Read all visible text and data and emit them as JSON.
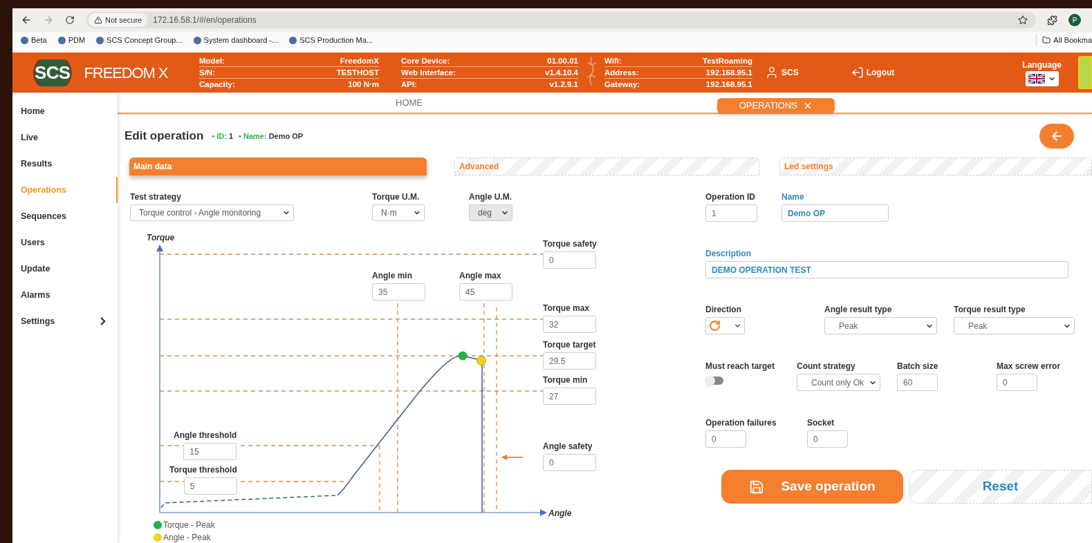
{
  "browser": {
    "security": "Not secure",
    "url": "172.16.58.1/#/en/operations",
    "profile": "P",
    "bookmarks": [
      "Beta",
      "PDM",
      "SCS Concept Group...",
      "System dashboard -...",
      "SCS Production Ma..."
    ],
    "all_bookmarks": "All Bookma"
  },
  "header": {
    "logo": "SCS",
    "product": "FREEDOM X",
    "info": [
      [
        {
          "label": "Model:",
          "value": "FreedomX"
        },
        {
          "label": "S/N:",
          "value": "TESTHOST"
        },
        {
          "label": "Capacity:",
          "value": "100 N·m"
        }
      ],
      [
        {
          "label": "Core Device:",
          "value": "01.00.01"
        },
        {
          "label": "Web Interface:",
          "value": "v1.4.10.4"
        },
        {
          "label": "API:",
          "value": "v1.2.9.1"
        }
      ],
      [
        {
          "label": "Wifi:",
          "value": "TestRoaming"
        },
        {
          "label": "Address:",
          "value": "192.168.95.1"
        },
        {
          "label": "Gateway:",
          "value": "192.168.95.1"
        }
      ]
    ],
    "user": "SCS",
    "logout": "Logout",
    "language": "Language"
  },
  "page_tabs": [
    {
      "label": "HOME",
      "selected": false
    },
    {
      "label": "OPERATIONS",
      "selected": true
    }
  ],
  "sidebar": {
    "items": [
      {
        "label": "Home",
        "selected": false
      },
      {
        "label": "Live",
        "selected": false
      },
      {
        "label": "Results",
        "selected": false
      },
      {
        "label": "Operations",
        "selected": true
      },
      {
        "label": "Sequences",
        "selected": false
      },
      {
        "label": "Users",
        "selected": false
      },
      {
        "label": "Update",
        "selected": false
      },
      {
        "label": "Alarms",
        "selected": false
      },
      {
        "label": "Settings",
        "selected": false,
        "expandable": true
      }
    ]
  },
  "title": "Edit operation",
  "id_label": "• ID:",
  "id_value": "1",
  "name_label": "• Name:",
  "name_value": "Demo OP",
  "section_tabs": [
    {
      "label": "Main data",
      "selected": true
    },
    {
      "label": "Advanced",
      "selected": false
    },
    {
      "label": "Led settings",
      "selected": false
    }
  ],
  "selects": [
    {
      "label": "Test strategy",
      "value": "Torque control - Angle monitoring",
      "disabled": false
    },
    {
      "label": "Torque U.M.",
      "value": "N·m",
      "disabled": false
    },
    {
      "label": "Angle U.M.",
      "value": "deg",
      "disabled": true
    }
  ],
  "chart": {
    "y_label": "Torque",
    "x_label": "Angle",
    "fields": [
      {
        "label": "Torque safety",
        "value": "0"
      },
      {
        "label": "Angle min",
        "value": "35"
      },
      {
        "label": "Angle max",
        "value": "45"
      },
      {
        "label": "Torque max",
        "value": "32"
      },
      {
        "label": "Torque target",
        "value": "29.5"
      },
      {
        "label": "Torque min",
        "value": "27"
      },
      {
        "label": "Angle safety",
        "value": "0"
      },
      {
        "label": "Angle threshold",
        "value": "15"
      },
      {
        "label": "Torque threshold",
        "value": "5"
      }
    ],
    "legend": [
      {
        "label": "Torque - Peak",
        "color": "#1db34a"
      },
      {
        "label": "Angle - Peak",
        "color": "#f2d318"
      }
    ]
  },
  "form_rows": [
    [
      {
        "kind": "input",
        "label": "Operation ID",
        "value": "1",
        "accent": false
      },
      {
        "kind": "input",
        "label": "Name",
        "value": "Demo OP",
        "accent": true
      }
    ],
    [
      {
        "kind": "input",
        "label": "Description",
        "value": "DEMO OPERATION TEST",
        "accent": true
      }
    ],
    [
      {
        "kind": "direction",
        "label": "Direction"
      },
      {
        "kind": "select",
        "label": "Angle result type",
        "value": "Peak"
      },
      {
        "kind": "select",
        "label": "Torque result type",
        "value": "Peak"
      }
    ],
    [
      {
        "kind": "toggle",
        "label": "Must reach target",
        "on": false
      },
      {
        "kind": "select",
        "label": "Count strategy",
        "value": "Count only Ok"
      },
      {
        "kind": "input",
        "label": "Batch size",
        "value": "60",
        "accent": false
      },
      {
        "kind": "input",
        "label": "Max screw error",
        "value": "0",
        "accent": false
      }
    ],
    [
      {
        "kind": "input",
        "label": "Operation failures",
        "value": "0",
        "accent": false
      },
      {
        "kind": "input",
        "label": "Socket",
        "value": "0",
        "accent": false
      }
    ]
  ],
  "buttons": {
    "save": "Save operation",
    "reset": "Reset"
  }
}
